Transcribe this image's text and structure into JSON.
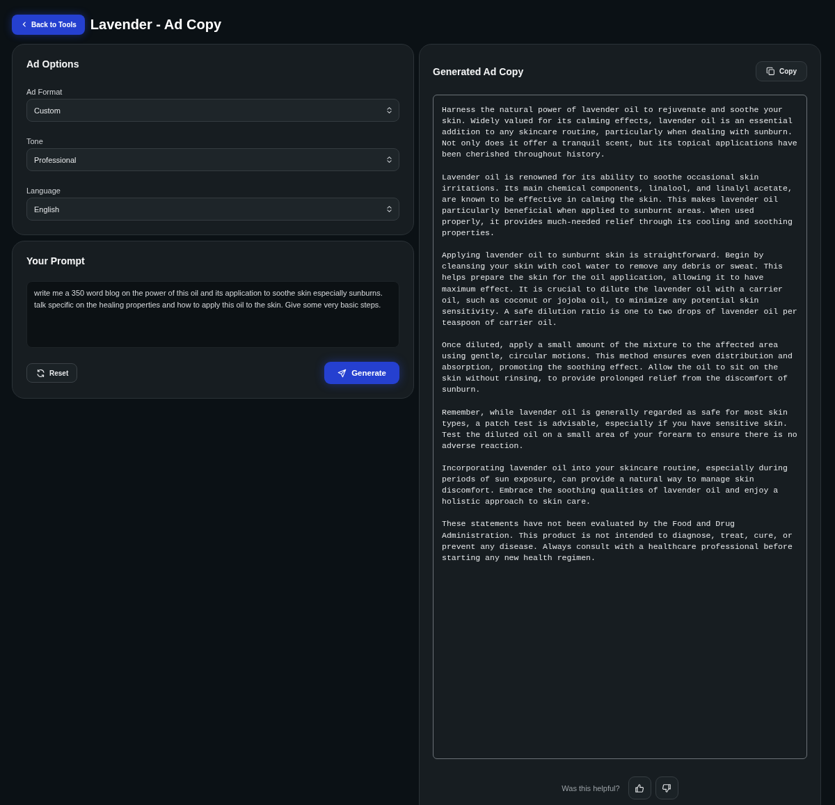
{
  "header": {
    "back_button": "Back to Tools",
    "title": "Lavender - Ad Copy"
  },
  "ad_options": {
    "title": "Ad Options",
    "fields": [
      {
        "label": "Ad Format",
        "value": "Custom"
      },
      {
        "label": "Tone",
        "value": "Professional"
      },
      {
        "label": "Language",
        "value": "English"
      }
    ]
  },
  "prompt": {
    "title": "Your Prompt",
    "value": "write me a 350 word blog on the power of this oil and its application to soothe skin especially sunburns. talk specific on the healing properties and how to apply this oil to the skin. Give some very basic steps.",
    "reset_button": "Reset",
    "generate_button": "Generate"
  },
  "output": {
    "title": "Generated Ad Copy",
    "copy_button": "Copy",
    "paragraphs": [
      "Harness the natural power of lavender oil to rejuvenate and soothe your skin. Widely valued for its calming effects, lavender oil is an essential addition to any skincare routine, particularly when dealing with sunburn. Not only does it offer a tranquil scent, but its topical applications have been cherished throughout history.",
      "Lavender oil is renowned for its ability to soothe occasional skin irritations. Its main chemical components, linalool, and linalyl acetate, are known to be effective in calming the skin. This makes lavender oil particularly beneficial when applied to sunburnt areas. When used properly, it provides much-needed relief through its cooling and soothing properties.",
      "Applying lavender oil to sunburnt skin is straightforward. Begin by cleansing your skin with cool water to remove any debris or sweat. This helps prepare the skin for the oil application, allowing it to have maximum effect. It is crucial to dilute the lavender oil with a carrier oil, such as coconut or jojoba oil, to minimize any potential skin sensitivity. A safe dilution ratio is one to two drops of lavender oil per teaspoon of carrier oil.",
      "Once diluted, apply a small amount of the mixture to the affected area using gentle, circular motions. This method ensures even distribution and absorption, promoting the soothing effect. Allow the oil to sit on the skin without rinsing, to provide prolonged relief from the discomfort of sunburn.",
      "Remember, while lavender oil is generally regarded as safe for most skin types, a patch test is advisable, especially if you have sensitive skin. Test the diluted oil on a small area of your forearm to ensure there is no adverse reaction.",
      "Incorporating lavender oil into your skincare routine, especially during periods of sun exposure, can provide a natural way to manage skin discomfort. Embrace the soothing qualities of lavender oil and enjoy a holistic approach to skin care.",
      "These statements have not been evaluated by the Food and Drug Administration. This product is not intended to diagnose, treat, cure, or prevent any disease. Always consult with a healthcare professional before starting any new health regimen."
    ],
    "feedback_question": "Was this helpful?"
  }
}
